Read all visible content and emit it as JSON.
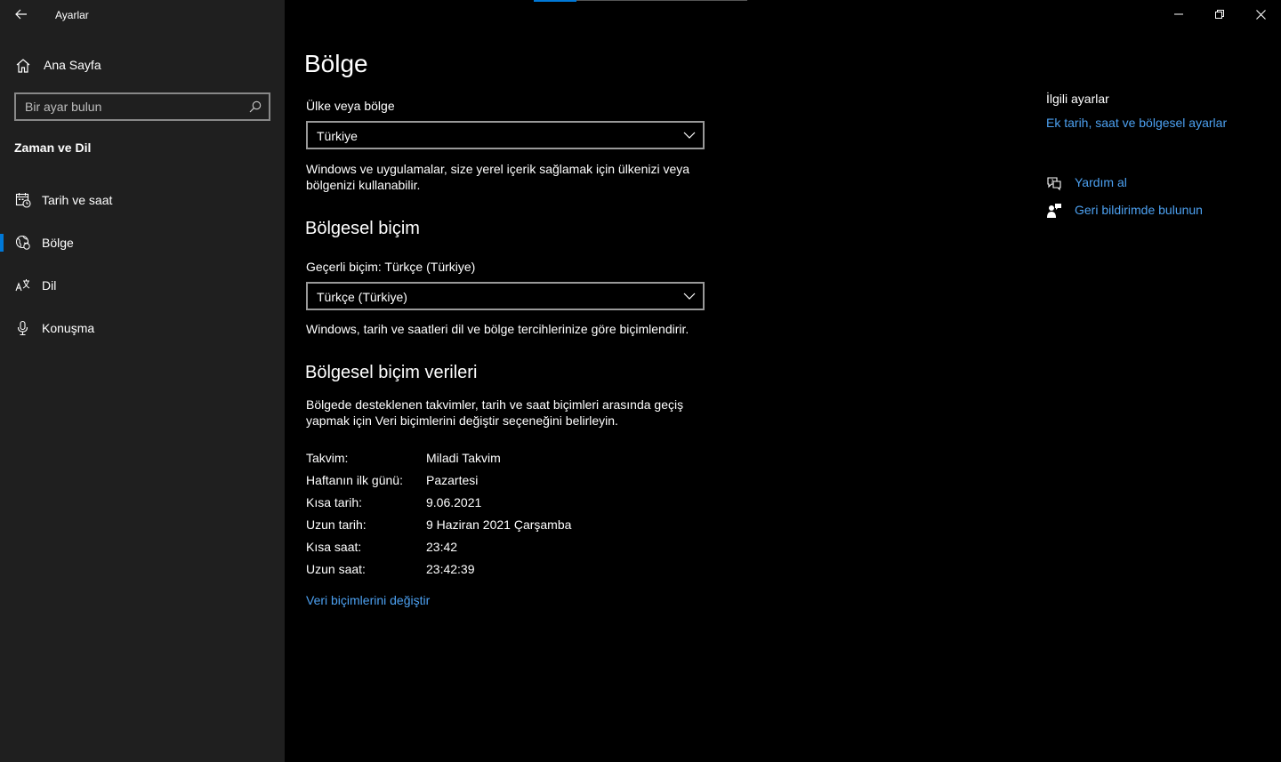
{
  "window": {
    "app_title": "Ayarlar"
  },
  "sidebar": {
    "home_label": "Ana Sayfa",
    "search_placeholder": "Bir ayar bulun",
    "section_title": "Zaman ve Dil",
    "items": [
      {
        "label": "Tarih ve saat",
        "icon": "calendar-clock-icon",
        "selected": false
      },
      {
        "label": "Bölge",
        "icon": "globe-region-icon",
        "selected": true
      },
      {
        "label": "Dil",
        "icon": "language-icon",
        "selected": false
      },
      {
        "label": "Konuşma",
        "icon": "microphone-icon",
        "selected": false
      }
    ]
  },
  "main": {
    "page_title": "Bölge",
    "country": {
      "label": "Ülke veya bölge",
      "value": "Türkiye",
      "description": "Windows ve uygulamalar, size yerel içerik sağlamak için ülkenizi veya bölgenizi kullanabilir."
    },
    "regional_format": {
      "heading": "Bölgesel biçim",
      "label": "Geçerli biçim: Türkçe (Türkiye)",
      "value": "Türkçe (Türkiye)",
      "description": "Windows, tarih ve saatleri dil ve bölge tercihlerinize göre biçimlendirir."
    },
    "format_data": {
      "heading": "Bölgesel biçim verileri",
      "description": "Bölgede desteklenen takvimler, tarih ve saat biçimleri arasında geçiş yapmak için Veri biçimlerini değiştir seçeneğini belirleyin.",
      "rows": [
        {
          "key": "Takvim:",
          "value": "Miladi Takvim"
        },
        {
          "key": "Haftanın ilk günü:",
          "value": "Pazartesi"
        },
        {
          "key": "Kısa tarih:",
          "value": "9.06.2021"
        },
        {
          "key": "Uzun tarih:",
          "value": "9 Haziran 2021 Çarşamba"
        },
        {
          "key": "Kısa saat:",
          "value": "23:42"
        },
        {
          "key": "Uzun saat:",
          "value": "23:42:39"
        }
      ],
      "change_link": "Veri biçimlerini değiştir"
    }
  },
  "related": {
    "title": "İlgili ayarlar",
    "link": "Ek tarih, saat ve bölgesel ayarlar",
    "help_label": "Yardım al",
    "feedback_label": "Geri bildirimde bulunun"
  },
  "colors": {
    "accent": "#0078d7",
    "link": "#4ca0f0",
    "sidebar_bg": "#1f1f1f",
    "main_bg": "#000000"
  }
}
